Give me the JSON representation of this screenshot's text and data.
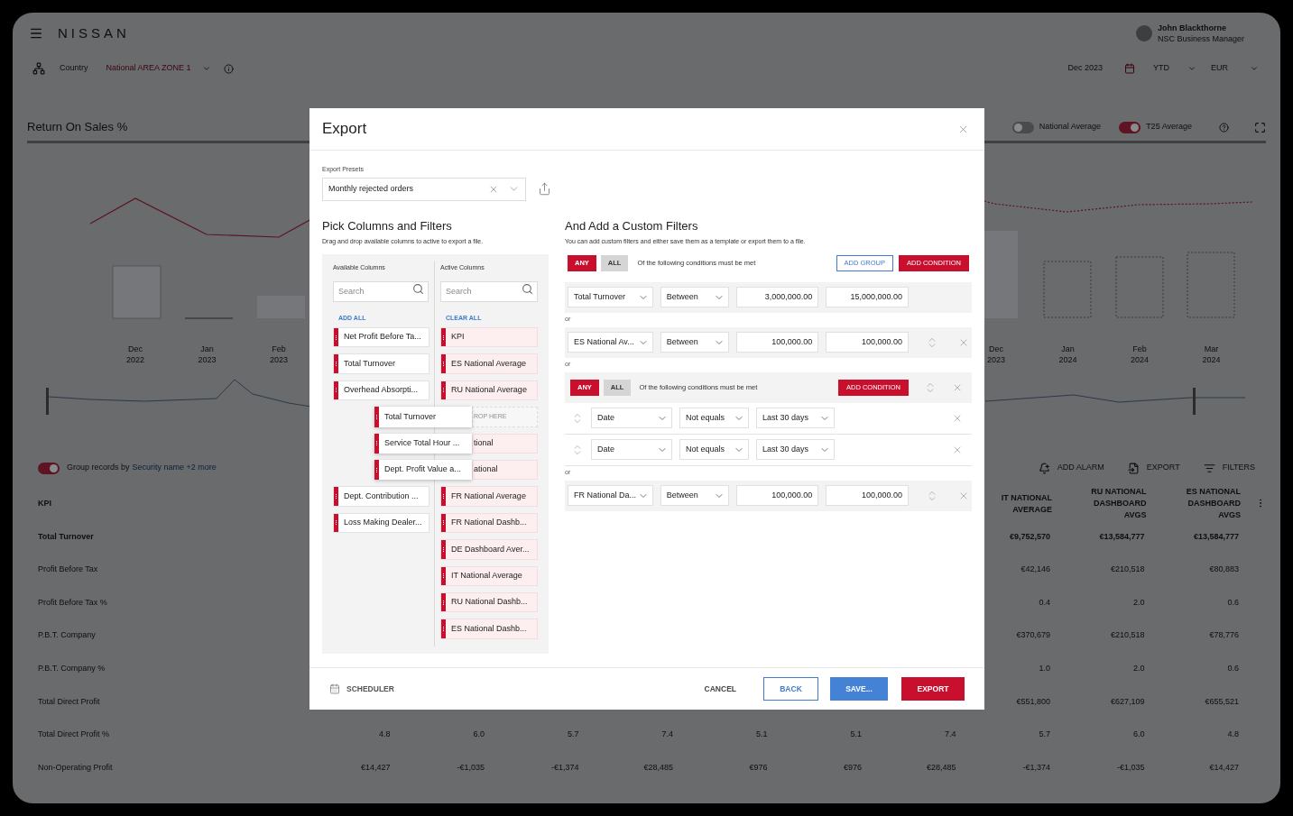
{
  "header": {
    "brand": "NISSAN",
    "user_name": "John Blackthorne",
    "user_role": "NSC Business Manager"
  },
  "filter_bar": {
    "level": "Country",
    "area": "National AREA ZONE 1",
    "period": "Dec 2023",
    "range": "YTD",
    "currency": "EUR"
  },
  "card": {
    "title": "Return On Sales %",
    "toggles": [
      {
        "label": "National Average",
        "on": false
      },
      {
        "label": "T25 Average",
        "on": true
      }
    ],
    "x_labels": [
      {
        "month": "Dec",
        "year": "2022"
      },
      {
        "month": "Jan",
        "year": "2023"
      },
      {
        "month": "Feb",
        "year": "2023"
      },
      {
        "month": "Dec",
        "year": "2023"
      },
      {
        "month": "Jan",
        "year": "2024"
      },
      {
        "month": "Feb",
        "year": "2024"
      },
      {
        "month": "Mar",
        "year": "2024"
      }
    ]
  },
  "grouping": {
    "on": true,
    "label": "Group records by",
    "link": "Security name +2 more"
  },
  "table_actions": [
    "ADD ALARM",
    "EXPORT",
    "FILTERS"
  ],
  "table": {
    "columns": [
      "KPI",
      "IT NATIONAL AVERAGE",
      "RU NATIONAL DASHBOARD AVGS",
      "ES NATIONAL DASHBOARD AVGS"
    ],
    "rows": [
      {
        "label": "Total Turnover",
        "emphasis": true,
        "values": [
          "€9,752,570",
          "€13,584,777",
          "€13,584,777"
        ]
      },
      {
        "label": "Profit Before Tax",
        "emphasis": false,
        "values": [
          "€42,146",
          "€210,518",
          "€80,883"
        ]
      },
      {
        "label": "Profit Before Tax %",
        "emphasis": false,
        "values": [
          "0.4",
          "2.0",
          "0.6"
        ]
      },
      {
        "label": "P.B.T. Company",
        "emphasis": false,
        "values": [
          "€370,679",
          "€210,518",
          "€78,776"
        ]
      },
      {
        "label": "P.B.T. Company %",
        "emphasis": false,
        "values": [
          "1.0",
          "2.0",
          "0.6"
        ]
      },
      {
        "label": "Total Direct Profit",
        "emphasis": false,
        "values": [
          "€551,800",
          "€627,109",
          "€655,521"
        ]
      },
      {
        "label": "Total Direct Profit %",
        "emphasis": false,
        "values": [
          "4.8",
          "6.0",
          "5.7",
          "7.4",
          "5.1",
          "5.1",
          "7.4",
          "5.7",
          "6.0",
          "4.8"
        ]
      },
      {
        "label": "Non-Operating Profit",
        "emphasis": false,
        "values": [
          "€14,427",
          "-€1,035",
          "-€1,374",
          "€28,485",
          "€976",
          "€976",
          "€28,485",
          "-€1,374",
          "-€1,035",
          "€14,427"
        ]
      }
    ]
  },
  "dialog": {
    "title": "Export",
    "preset": {
      "label": "Export Presets",
      "value": "Monthly rejected orders"
    },
    "columns_section": {
      "title": "Pick Columns and Filters",
      "subtitle": "Drag and drop available columns to active to export a file.",
      "available": {
        "label": "Available Columns",
        "search_placeholder": "Search",
        "action": "ADD ALL",
        "items": [
          {
            "kind": "column",
            "label": "Net Profit Before Ta..."
          },
          {
            "kind": "column",
            "label": "Total Turnover"
          },
          {
            "kind": "column",
            "label": "Overhead Absorpti..."
          },
          {
            "kind": "dragging",
            "label": "Total Turnover"
          },
          {
            "kind": "dragging",
            "label": "Service Total Hour ..."
          },
          {
            "kind": "dragging",
            "label": "Dept. Profit Value a..."
          },
          {
            "kind": "column",
            "label": "Dept. Contribution ..."
          },
          {
            "kind": "column",
            "label": "Loss Making Dealer..."
          }
        ]
      },
      "active": {
        "label": "Active Columns",
        "search_placeholder": "Search",
        "action": "CLEAR ALL",
        "items": [
          {
            "kind": "column",
            "label": "KPI",
            "covered": false
          },
          {
            "kind": "column",
            "label": "ES National Average",
            "covered": false
          },
          {
            "kind": "column",
            "label": "RU National Average",
            "covered": false
          },
          {
            "kind": "drop_zone",
            "label": "ROP HERE",
            "covered": true
          },
          {
            "kind": "column",
            "label": "tional",
            "covered": true
          },
          {
            "kind": "column",
            "label": "ational",
            "covered": true
          },
          {
            "kind": "column",
            "label": "FR National Average",
            "covered": false
          },
          {
            "kind": "column",
            "label": "FR National Dashb...",
            "covered": false
          },
          {
            "kind": "column",
            "label": "DE Dashboard Aver...",
            "covered": false
          },
          {
            "kind": "column",
            "label": "IT National Average",
            "covered": false
          },
          {
            "kind": "column",
            "label": "RU National Dashb...",
            "covered": false
          },
          {
            "kind": "column",
            "label": "ES National Dashb...",
            "covered": false
          }
        ]
      }
    },
    "filters_section": {
      "title": "And Add a Custom Filters",
      "subtitle": "You can add custom filters and either save them as a template or export them to a file.",
      "match": [
        {
          "label": "ANY",
          "selected": true
        },
        {
          "label": "ALL",
          "selected": false
        }
      ],
      "match_text": "Of the following conditions must be met",
      "add_group": "ADD GROUP",
      "add_condition": "ADD CONDITION",
      "items": [
        {
          "kind": "condition",
          "field": "Total Turnover",
          "operator": "Between",
          "value_from": "3,000,000.00",
          "value_to": "15,000,000.00",
          "reorderable": false,
          "removable": false
        },
        {
          "kind": "separator",
          "label": "or"
        },
        {
          "kind": "condition",
          "field": "ES National Av...",
          "operator": "Between",
          "value_from": "100,000.00",
          "value_to": "100,000.00",
          "reorderable": true,
          "removable": true
        },
        {
          "kind": "separator",
          "label": "or"
        },
        {
          "kind": "group",
          "match": [
            {
              "label": "ANY",
              "selected": true
            },
            {
              "label": "ALL",
              "selected": false
            }
          ],
          "match_text": "Of the following conditions must be met",
          "add_condition": "ADD CONDITION",
          "reorderable": true,
          "removable": true,
          "conditions": [
            {
              "field": "Date",
              "operator": "Not equals",
              "value": "Last 30 days"
            },
            {
              "field": "Date",
              "operator": "Not equals",
              "value": "Last 30 days"
            }
          ]
        },
        {
          "kind": "separator",
          "label": "or"
        },
        {
          "kind": "condition",
          "field": "FR National Da...",
          "operator": "Between",
          "value_from": "100,000.00",
          "value_to": "100,000.00",
          "reorderable": true,
          "removable": true
        }
      ]
    },
    "footer": {
      "scheduler": "SCHEDULER",
      "cancel": "CANCEL",
      "back": "BACK",
      "save": "SAVE...",
      "export": "EXPORT"
    }
  }
}
